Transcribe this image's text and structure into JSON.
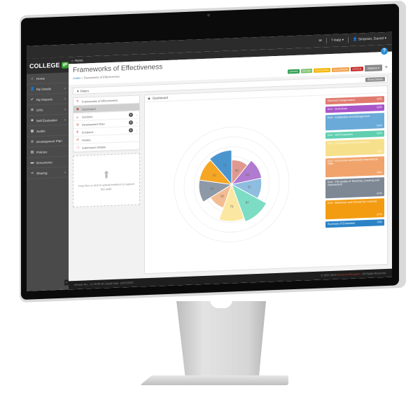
{
  "topbar": {
    "mail_icon": "envelope-icon",
    "help_label": "Help",
    "user_label": "Simpson, Daniel"
  },
  "logo": {
    "text": "COLLEGE",
    "badge": "iP"
  },
  "sidebar": {
    "items": [
      {
        "label": "Home",
        "icon": "home-icon",
        "chevron": false
      },
      {
        "label": "My Details",
        "icon": "user-icon",
        "chevron": true
      },
      {
        "label": "My Reports",
        "icon": "check-icon",
        "chevron": true
      },
      {
        "label": "CPD",
        "icon": "gear-icon",
        "chevron": true
      },
      {
        "label": "Self Evaluation",
        "icon": "puzzle-icon",
        "chevron": true
      },
      {
        "label": "Audits",
        "icon": "chart-icon",
        "chevron": false
      },
      {
        "label": "Development Plan",
        "icon": "target-icon",
        "chevron": false
      },
      {
        "label": "Policies",
        "icon": "file-icon",
        "chevron": false
      },
      {
        "label": "Documents",
        "icon": "folder-icon",
        "chevron": false
      },
      {
        "label": "Sharing",
        "icon": "share-icon",
        "chevron": true
      }
    ]
  },
  "header": {
    "home_crumb": "Home",
    "title": "Frameworks of Effectiveness",
    "breadcrumb_link": "Audits",
    "breadcrumb_sep": "»",
    "breadcrumb_current": "Frameworks of Effectiveness",
    "help_glyph": "?"
  },
  "badges": [
    {
      "label": "Leading",
      "color": "#2e9e4f"
    },
    {
      "label": "Secure",
      "color": "#7cc26b"
    },
    {
      "label": "Developing",
      "color": "#f4b400"
    },
    {
      "label": "Challenging",
      "color": "#f0a04b"
    },
    {
      "label": "Critical",
      "color": "#c62828"
    }
  ],
  "toolbar": {
    "options_label": "Options ▾",
    "plus_label": "+"
  },
  "filters": {
    "label": "Filters",
    "show_details_label": "Show Details"
  },
  "nav": {
    "items": [
      {
        "label": "Frameworks of Effectiveness",
        "icon": "edit-icon",
        "count": null,
        "arrow": false,
        "active": false
      },
      {
        "label": "Dashboard",
        "icon": "dashboard-icon",
        "count": null,
        "arrow": false,
        "active": true
      },
      {
        "label": "Sections",
        "icon": "list-icon",
        "count": "5",
        "arrow": true,
        "active": false
      },
      {
        "label": "Development Plan",
        "icon": "target-icon",
        "count": "0",
        "arrow": true,
        "active": false
      },
      {
        "label": "Evidence",
        "icon": "paperclip-icon",
        "count": "0",
        "arrow": true,
        "active": false
      },
      {
        "label": "History",
        "icon": "history-icon",
        "count": null,
        "arrow": false,
        "active": false
      },
      {
        "label": "Submission Details",
        "icon": "info-icon",
        "count": null,
        "arrow": false,
        "active": false
      }
    ]
  },
  "dropzone": {
    "text": "Drop files or click to upload evidence to support this audit."
  },
  "dashboard": {
    "title": "Dashboard"
  },
  "chart_data": {
    "type": "polar-area",
    "title": "",
    "rmax": 100,
    "categories": [
      "External Categorisation",
      "KA1 - Outcomes",
      "KA2 - Leadership and Management",
      "KA2 - Self Evaluation",
      "KA2 - Compliance and Governance",
      "KA3 - Curriculum and Broader educational Offer",
      "KA4 - The quality of Teaching, Learning and Assessment",
      "KA5 - Behaviour and Climate for Learning",
      "Summary of Evaluation"
    ],
    "values": [
      50,
      62,
      61,
      82,
      75,
      50,
      67,
      67,
      70
    ],
    "colors": [
      "#e0998f",
      "#b07ad0",
      "#8fbde0",
      "#7ddcc4",
      "#fbe7a1",
      "#f3bc91",
      "#8e99a8",
      "#f5a623",
      "#4b95cf"
    ],
    "grid": true,
    "legend": "right"
  },
  "legend": [
    {
      "label": "External Categorisation",
      "pct": "50%",
      "color": "#e07a6f",
      "size": "short"
    },
    {
      "label": "KA1 - Outcomes",
      "pct": "62%",
      "color": "#a855c8",
      "size": "short"
    },
    {
      "label": "KA2 - Leadership and Management",
      "pct": "61%",
      "color": "#6aaad8",
      "size": "tall"
    },
    {
      "label": "KA2 - Self Evaluation",
      "pct": "82%",
      "color": "#5fcfb0",
      "size": "short"
    },
    {
      "label": "KA2 - Compliance and Governance",
      "pct": "75%",
      "color": "#f7e08c",
      "size": "tall"
    },
    {
      "label": "KA3 - Curriculum and Broader educational Offer",
      "pct": "50%",
      "color": "#f0a46b",
      "size": "taller"
    },
    {
      "label": "KA4 - The quality of Teaching, Learning and Assessment",
      "pct": "67%",
      "color": "#7d8894",
      "size": "taller"
    },
    {
      "label": "KA5 - Behaviour and Climate for Learning",
      "pct": "67%",
      "color": "#f39c12",
      "size": "taller"
    },
    {
      "label": "Summary of Evaluation",
      "pct": "70%",
      "color": "#2b83c6",
      "size": "short"
    }
  ],
  "footer": {
    "version": "Version No. : 11.20.00.00",
    "sep": "|",
    "build": "Build Date: 15/07/2023",
    "copyright_pre": "© 2007-2023",
    "brand": "Servertio Education",
    "copyright_post": ". All Rights Reserved."
  }
}
